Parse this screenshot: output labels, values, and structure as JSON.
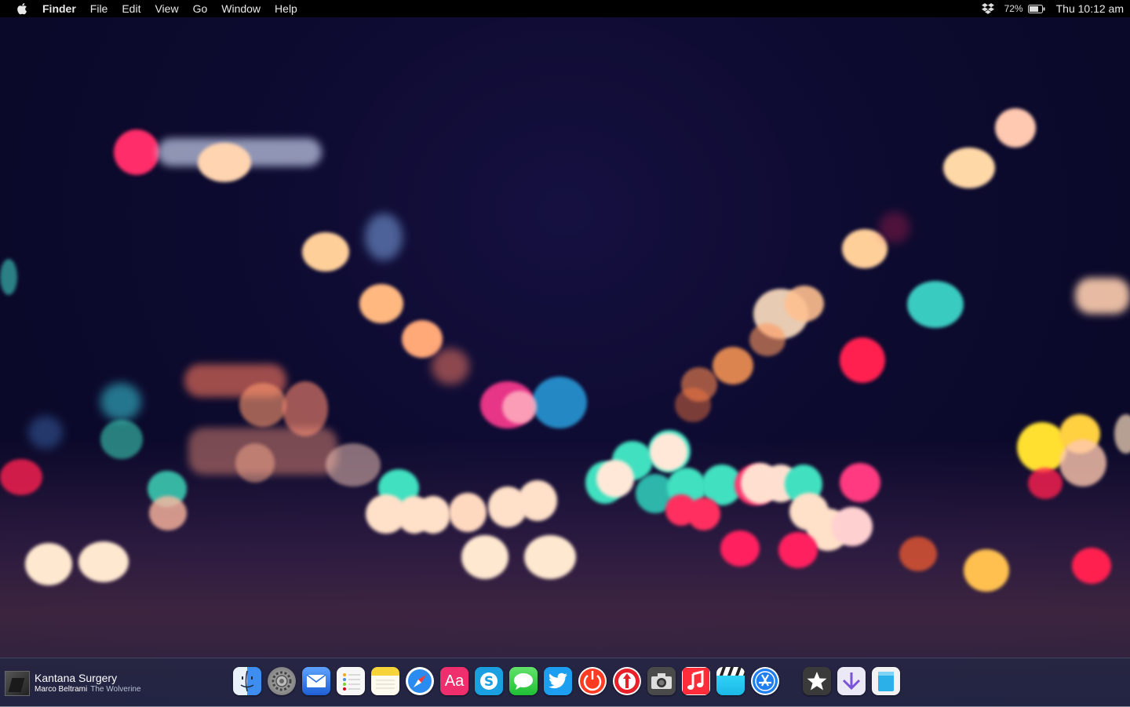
{
  "menubar": {
    "app_name": "Finder",
    "items": [
      "File",
      "Edit",
      "View",
      "Go",
      "Window",
      "Help"
    ],
    "battery_percent": "72%",
    "clock": "Thu 10:12 am",
    "icons": [
      "apple-icon",
      "dropbox-icon",
      "battery-icon"
    ]
  },
  "now_playing": {
    "title": "Kantana Surgery",
    "artist": "Marco Beltrami",
    "album": "The Wolverine"
  },
  "dock": {
    "apps": [
      {
        "name": "finder",
        "icon": "finder-icon",
        "color": "#3d8ef0"
      },
      {
        "name": "system-preferences",
        "icon": "gear-icon",
        "color": "#8a8a8a"
      },
      {
        "name": "mail",
        "icon": "mail-icon",
        "color": "#2a6fe0"
      },
      {
        "name": "reminders",
        "icon": "reminders-icon",
        "color": "#f4f4f4"
      },
      {
        "name": "notes",
        "icon": "notes-icon",
        "color": "#f7d43a"
      },
      {
        "name": "safari",
        "icon": "compass-icon",
        "color": "#2a8cf0"
      },
      {
        "name": "dictionary",
        "icon": "dictionary-icon",
        "color": "#ef2f6d",
        "label": "Aa"
      },
      {
        "name": "skype",
        "icon": "skype-icon",
        "color": "#14a7e8"
      },
      {
        "name": "messages",
        "icon": "messages-icon",
        "color": "#3ad34c"
      },
      {
        "name": "twitter",
        "icon": "twitter-icon",
        "color": "#1c9ff0"
      },
      {
        "name": "power-app",
        "icon": "power-icon",
        "color": "#ff3b22"
      },
      {
        "name": "transmit",
        "icon": "upload-arrow-icon",
        "color": "#e8202a"
      },
      {
        "name": "screenshot",
        "icon": "camera-icon",
        "color": "#555555"
      },
      {
        "name": "itunes",
        "icon": "music-note-icon",
        "color": "#ff2d3a"
      },
      {
        "name": "final-cut",
        "icon": "clapperboard-icon",
        "color": "#1ab8e8"
      },
      {
        "name": "app-store",
        "icon": "app-store-icon",
        "color": "#1f7ef2"
      },
      {
        "name": "reeder",
        "icon": "star-icon",
        "color": "#3a3a3a"
      },
      {
        "name": "downloads",
        "icon": "download-icon",
        "color": "#e9e6f4"
      },
      {
        "name": "trash",
        "icon": "trash-icon",
        "color": "#2bb0e8"
      }
    ]
  },
  "wallpaper": {
    "style": "night city bokeh",
    "colors": [
      "#0c0a2e",
      "#ffd4b0",
      "#ff2d6a",
      "#3de0c0",
      "#ffa060",
      "#ffe040"
    ]
  }
}
